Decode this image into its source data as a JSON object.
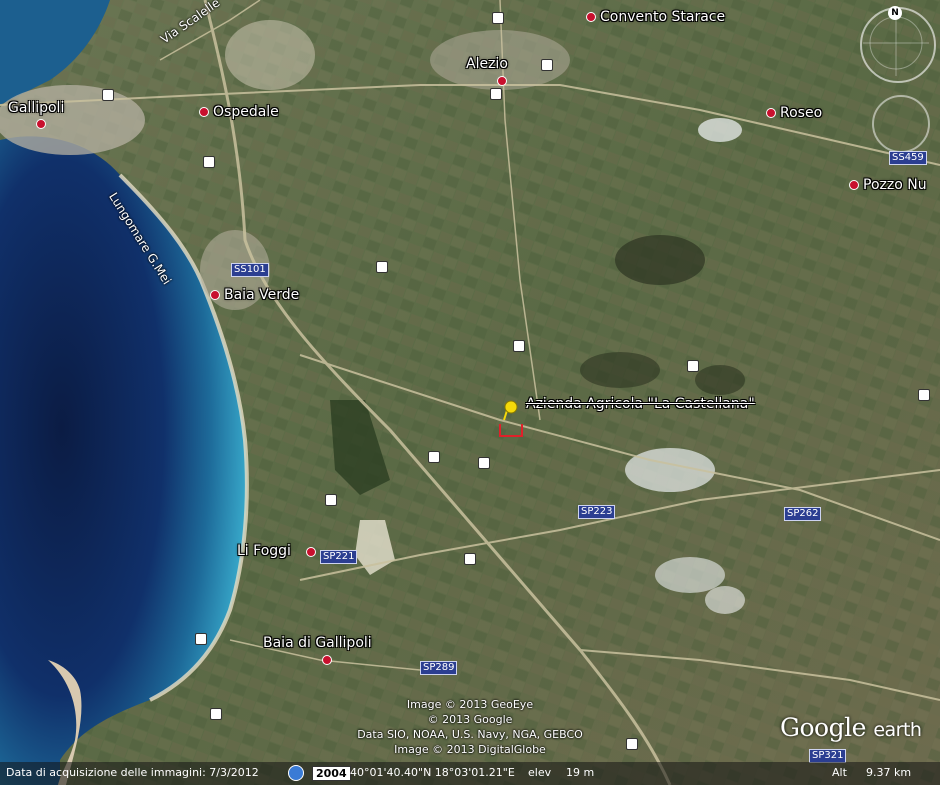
{
  "places": {
    "convento_starace": "Convento Starace",
    "alezio": "Alezio",
    "gallipoli": "Gallipoli",
    "ospedale": "Ospedale",
    "roseo": "Roseo",
    "pozzo_nu": "Pozzo Nu",
    "baia_verde": "Baia Verde",
    "li_foggi": "Li Foggi",
    "baia_di_gallipoli": "Baia di Gallipoli"
  },
  "streets": {
    "via_scalelle": "Via Scalelle",
    "lungomare": "Lungomare G.Mei"
  },
  "roads": {
    "ss459": "SS459",
    "ss101": "SS101",
    "sp223": "SP223",
    "sp262": "SP262",
    "sp221": "SP221",
    "sp289": "SP289",
    "sp321": "SP321"
  },
  "placemark": {
    "label": "Azienda Agricola \"La Castellana\""
  },
  "compass": {
    "north": "N"
  },
  "credits": {
    "line1": "Image © 2013 GeoEye",
    "line2": "© 2013 Google",
    "line3": "Data SIO, NOAA, U.S. Navy, NGA, GEBCO",
    "line4": "Image © 2013 DigitalGlobe"
  },
  "logo": {
    "main": "Google",
    "sub": "earth"
  },
  "status": {
    "acquisition": "Data di acquisizione delle immagini: 7/3/2012",
    "year": "2004",
    "coords": "40°01'40.40\"N  18°03'01.21\"E",
    "elev_label": "elev",
    "elev_value": "19 m",
    "alt_label": "Alt",
    "alt_value": "9.37 km"
  },
  "colors": {
    "sea_deep": "#0d2350",
    "sea_shallow": "#2a8fb8",
    "land": "#5b6a45",
    "road_badge": "#2b3e91",
    "place_dot": "#c8102e",
    "pin": "#f5d90a",
    "parcel": "#e0202a"
  }
}
